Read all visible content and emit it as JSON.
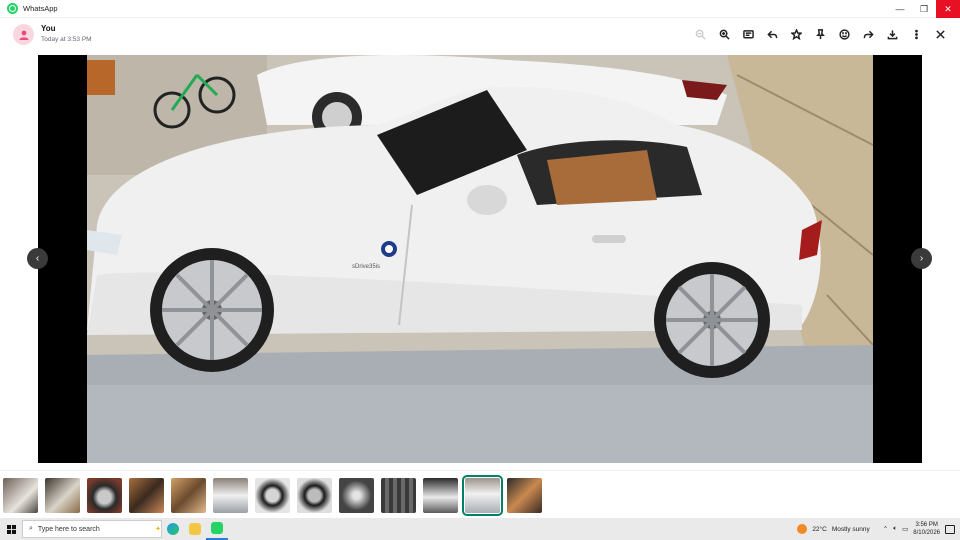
{
  "window": {
    "title": "WhatsApp",
    "controls": {
      "minimize": "—",
      "maximize": "❐",
      "close": "✕"
    }
  },
  "header": {
    "sender": "You",
    "timestamp": "Today at 3:53 PM",
    "toolbar_icons": [
      "search-icon",
      "zoom-in-icon",
      "message-icon",
      "reply-icon",
      "star-icon",
      "pin-icon",
      "emoji-icon",
      "forward-icon",
      "download-icon",
      "more-icon",
      "close-icon"
    ]
  },
  "viewer": {
    "image_subject": "white-bmw-convertible",
    "badge_text": "sDrive35is",
    "prev_arrow": "‹",
    "next_arrow": "›"
  },
  "thumbnails": {
    "count": 13,
    "selected_index": 11
  },
  "taskbar": {
    "search_placeholder": "Type here to search",
    "weather_temp": "22°C",
    "weather_text": "Mostly sunny",
    "time": "3:56 PM",
    "date": "8/10/2026"
  },
  "colors": {
    "accent": "#008069",
    "close_red": "#e81123",
    "whatsapp_green": "#25D366"
  }
}
